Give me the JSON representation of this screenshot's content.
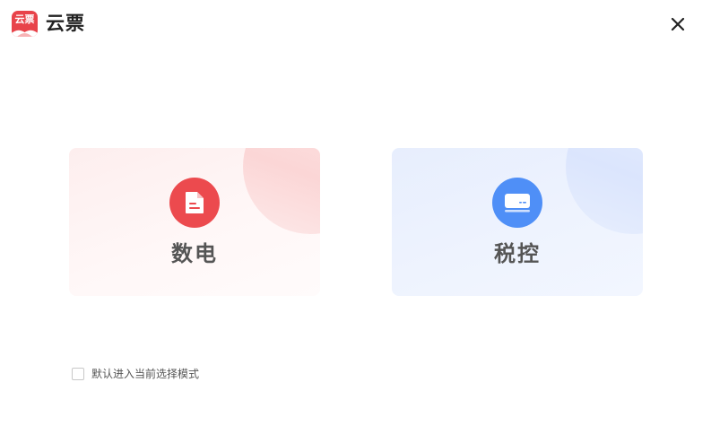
{
  "header": {
    "logo_text": "云票",
    "app_title": "云票",
    "close_icon": "close-icon"
  },
  "modes": [
    {
      "label": "数电",
      "icon": "document-icon",
      "accent": "#ec4a4e"
    },
    {
      "label": "税控",
      "icon": "tax-device-icon",
      "accent": "#4f8ff7"
    }
  ],
  "default_option": {
    "label": "默认进入当前选择模式",
    "checked": false
  }
}
